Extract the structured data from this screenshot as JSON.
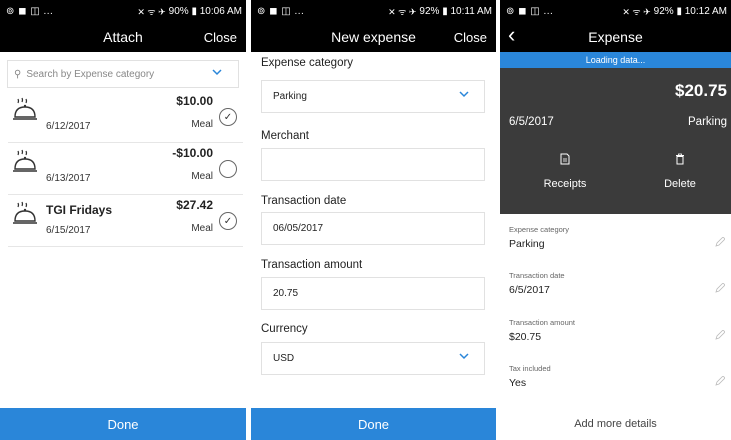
{
  "colors": {
    "accent": "#2a86d9",
    "bar_black": "#000000",
    "dark_card": "#3b3b3b"
  },
  "screen1": {
    "status": {
      "left": "⊚ ◼ ◫ ...",
      "right": "90% ▮ 10:06 AM"
    },
    "title": "Attach",
    "close_label": "Close",
    "search_placeholder": "Search by Expense category",
    "transactions": [
      {
        "merchant": "",
        "amount": "$10.00",
        "date": "6/12/2017",
        "category": "Meal",
        "selected": "✓",
        "icon": "meal-icon"
      },
      {
        "merchant": "",
        "amount": "-$10.00",
        "date": "6/13/2017",
        "category": "Meal",
        "selected": "",
        "icon": "meal-icon"
      },
      {
        "merchant": "TGI Fridays",
        "amount": "$27.42",
        "date": "6/15/2017",
        "category": "Meal",
        "selected": "✓",
        "icon": "meal-icon"
      }
    ],
    "done_label": "Done"
  },
  "screen2": {
    "status": {
      "left": "⊚ ◼ ◫ ...",
      "right": "92% ▮ 10:11 AM"
    },
    "title": "New expense",
    "close_label": "Close",
    "fields": {
      "category": {
        "label": "Expense category",
        "value": "Parking"
      },
      "merchant": {
        "label": "Merchant",
        "value": ""
      },
      "date": {
        "label": "Transaction date",
        "value": "06/05/2017"
      },
      "amount": {
        "label": "Transaction amount",
        "value": "20.75"
      },
      "currency": {
        "label": "Currency",
        "value": "USD"
      }
    },
    "done_label": "Done"
  },
  "screen3": {
    "status": {
      "left": "⊚ ◼ ◫ ...",
      "right": "92% ▮ 10:12 AM"
    },
    "title": "Expense",
    "loading": "Loading data...",
    "amount": "$20.75",
    "date": "6/5/2017",
    "category": "Parking",
    "receipts_label": "Receipts",
    "delete_label": "Delete",
    "details": [
      {
        "label": "Expense category",
        "value": "Parking"
      },
      {
        "label": "Transaction date",
        "value": "6/5/2017"
      },
      {
        "label": "Transaction amount",
        "value": "$20.75"
      },
      {
        "label": "Tax included",
        "value": "Yes"
      }
    ],
    "add_more": "Add more details"
  }
}
